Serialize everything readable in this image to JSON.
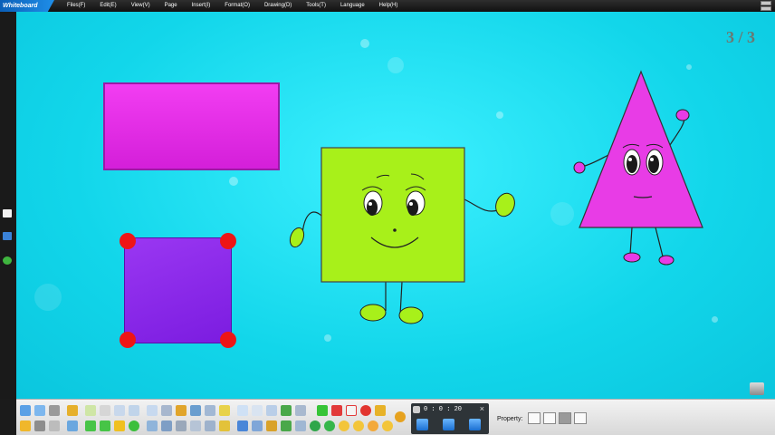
{
  "app": {
    "logo_text": "Whiteboard"
  },
  "menu": [
    "Files(F)",
    "Edit(E)",
    "View(V)",
    "Page",
    "Insert(I)",
    "Format(O)",
    "Drawing(D)",
    "Tools(T)",
    "Language",
    "Help(H)"
  ],
  "canvas": {
    "page_counter": "3 / 3",
    "accent": "#12d6ea",
    "shapes": [
      {
        "name": "pink-rectangle",
        "color": "#e52fe8"
      },
      {
        "name": "purple-square",
        "color": "#8a2be6",
        "corner_color": "#ee1515"
      },
      {
        "name": "green-square-character",
        "color": "#a8f01a"
      },
      {
        "name": "pink-triangle-character",
        "color": "#e83ce6"
      }
    ]
  },
  "toolbar": {
    "timer": {
      "value": "0 : 0 : 20",
      "close": "×"
    },
    "property_label": "Property:"
  }
}
